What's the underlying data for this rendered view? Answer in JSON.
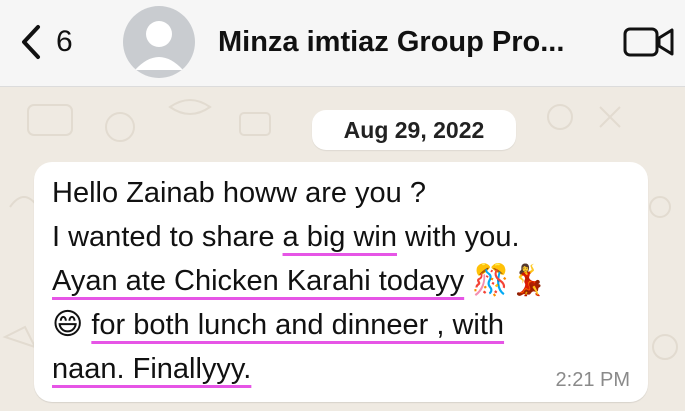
{
  "header": {
    "back_count": "6",
    "title": "Minza imtiaz Group Pro..."
  },
  "chat": {
    "date": "Aug 29, 2022",
    "message": {
      "line1": "Hello Zainab howw are you ?",
      "line2_pre": "I wanted to share ",
      "line2_u": "a big win",
      "line2_post": " with you.",
      "line3": "Ayan ate Chicken Karahi todayy",
      "line3_emoji": "🎊💃",
      "line4_emoji": "😄",
      "line4": "for both lunch and dinneer , with",
      "line5": "naan. Finallyyy.",
      "time": "2:21 PM"
    }
  },
  "colors": {
    "underline": "#e655e6",
    "bubble": "#ffffff",
    "wallpaper": "#efeae2"
  }
}
